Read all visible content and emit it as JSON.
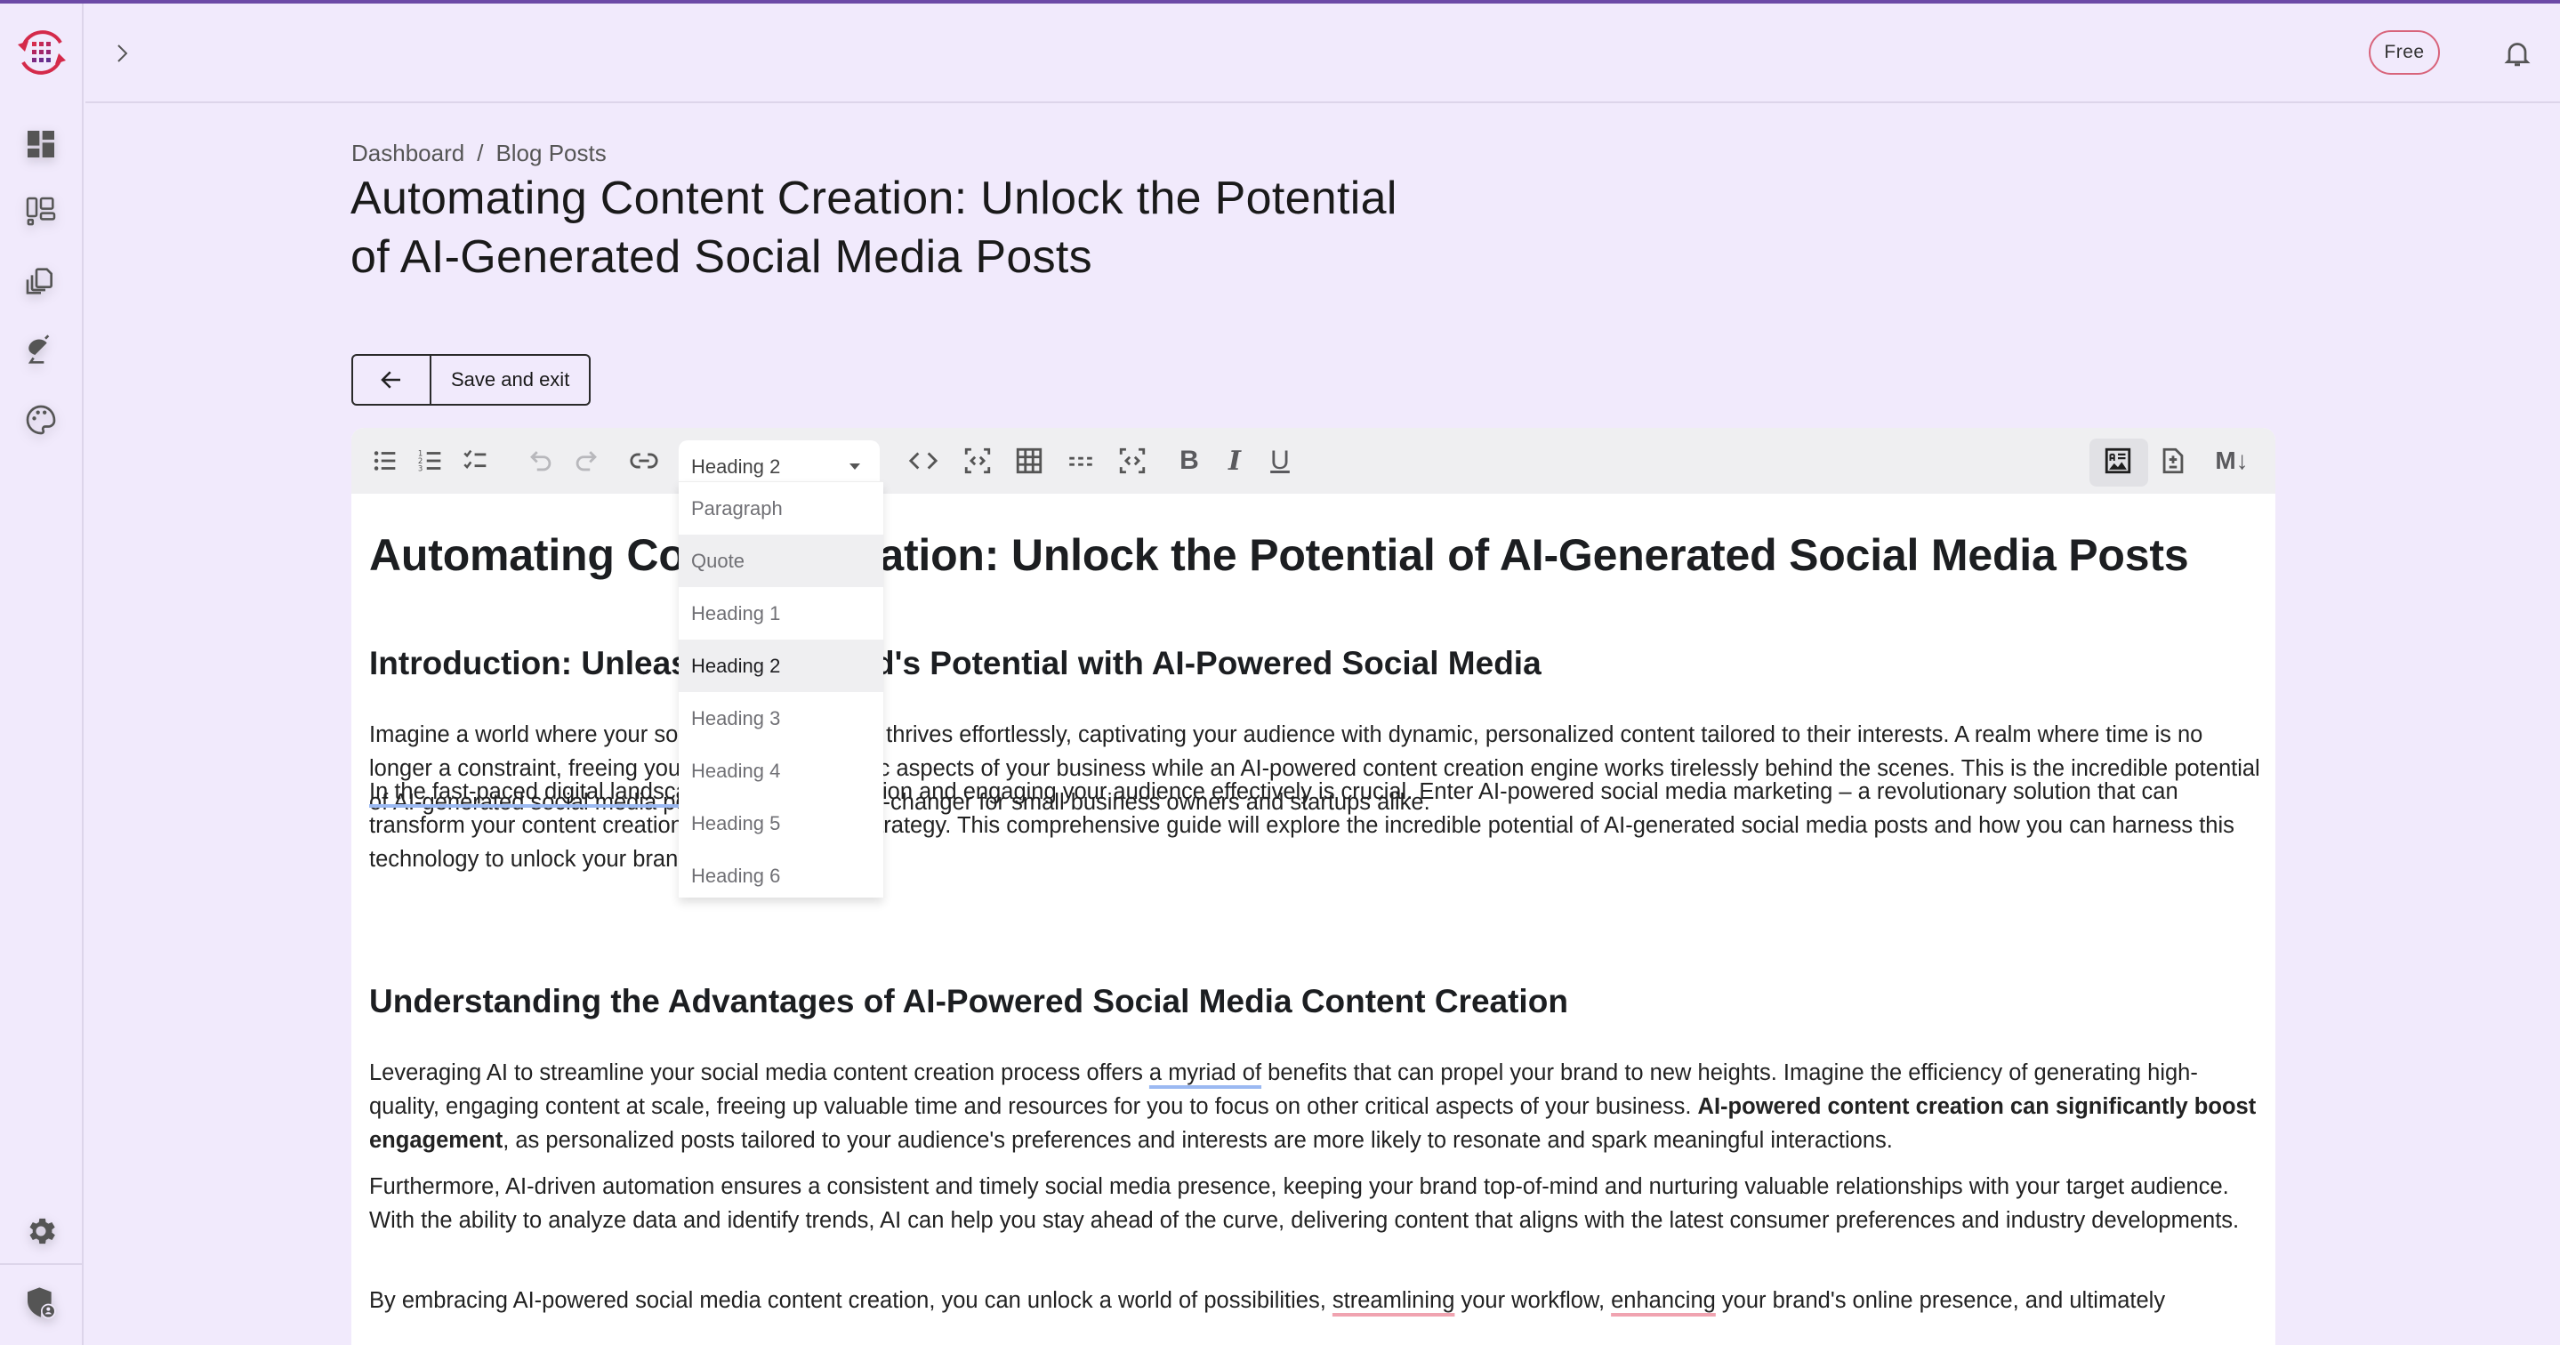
{
  "header": {
    "plan_badge": "Free"
  },
  "sidebar": {
    "items": [
      {
        "name": "dashboard"
      },
      {
        "name": "layouts"
      },
      {
        "name": "documents"
      },
      {
        "name": "publish"
      },
      {
        "name": "themes"
      }
    ],
    "bottom_items": [
      {
        "name": "settings"
      },
      {
        "name": "admin"
      }
    ]
  },
  "breadcrumb": {
    "items": [
      "Dashboard",
      "Blog Posts"
    ],
    "separator": "/"
  },
  "page": {
    "title": "Automating Content Creation: Unlock the Potential of AI-Generated Social Media Posts",
    "save_exit_label": "Save and exit"
  },
  "toolbar": {
    "block_type_selected": "Heading 2",
    "tools": [
      "bullet-list",
      "numbered-list",
      "check-list",
      "undo",
      "redo",
      "link",
      "block-type",
      "code",
      "code-block",
      "table",
      "horizontal-rule",
      "embed",
      "bold",
      "italic",
      "underline"
    ],
    "bold_label": "B",
    "italic_label": "I",
    "underline_label": "U",
    "views": [
      "rich-text",
      "diff",
      "markdown"
    ],
    "markdown_label": "M↓",
    "active_view": "rich-text"
  },
  "block_dropdown": {
    "options": [
      "Paragraph",
      "Quote",
      "Heading 1",
      "Heading 2",
      "Heading 3",
      "Heading 4",
      "Heading 5",
      "Heading 6"
    ],
    "selected": "Heading 2",
    "hovered": "Quote"
  },
  "document": {
    "h1": "Automating Content Creation: Unlock the Potential of AI-Generated Social Media Posts",
    "h2_intro": "Introduction: Unleash Your Brand's Potential with AI-Powered Social Media",
    "p1": "Imagine a world where your social media presence thrives effortlessly, captivating your audience with dynamic, personalized content tailored to their interests. A realm where time is no longer a constraint, freeing you to focus on strategic aspects of your business while an AI-powered content creation engine works tirelessly behind the scenes. This is the incredible potential of AI-generated social media posts, and it's a game-changer for small business owners and startups alike.",
    "p2_underlined": "In the fast-paced digital landscape",
    "p2_rest": ", capturing attention and engaging your audience effectively is crucial. Enter AI-powered social media marketing – a revolutionary solution that can transform your content creation and social media strategy. This comprehensive guide will explore the incredible potential of AI-generated social media posts and how you can harness this technology to unlock your brand's true potential.",
    "h2_advantages": "Understanding the Advantages of AI-Powered Social Media Content Creation",
    "p3_a": "Leveraging AI to streamline your social media content creation process offers ",
    "p3_underlined": "a myriad of",
    "p3_b": " benefits that can propel your brand to new heights. Imagine the efficiency of generating high-quality, engaging content at scale, freeing up valuable time and resources for you to focus on other critical aspects of your business. ",
    "p3_bold": "AI-powered content creation can significantly boost engagement",
    "p3_c": ", as personalized posts tailored to your audience's preferences and interests are more likely to resonate and spark meaningful interactions.",
    "p4": "Furthermore, AI-driven automation ensures a consistent and timely social media presence, keeping your brand top-of-mind and nurturing valuable relationships with your target audience. With the ability to analyze data and identify trends, AI can help you stay ahead of the curve, delivering content that aligns with the latest consumer preferences and industry developments.",
    "p5_a": "By embracing AI-powered social media content creation, you can unlock a world of possibilities, ",
    "p5_red1": "streamlining",
    "p5_b": " your workflow, ",
    "p5_red2": "enhancing",
    "p5_c": " your brand's online presence, and ultimately"
  },
  "colors": {
    "accent": "#6c4aa6",
    "badge_border": "#d8647b",
    "background": "#f1eafc",
    "underline_suggestion": "#9bb9f2",
    "underline_spelling": "#f0a3b0"
  }
}
